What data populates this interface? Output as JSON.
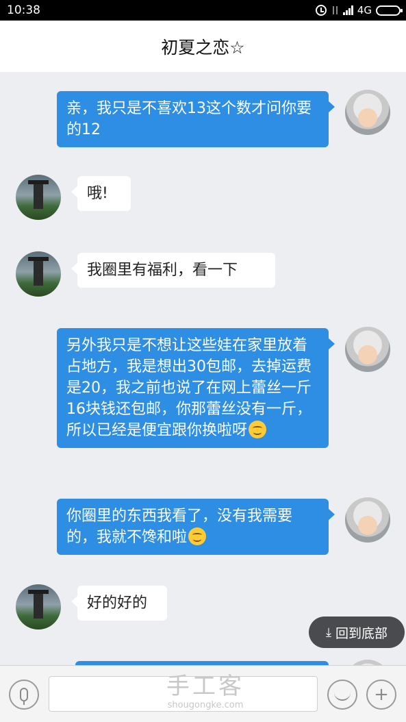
{
  "status_bar": {
    "time": "10:38",
    "network": "4G"
  },
  "header": {
    "title": "初夏之恋☆"
  },
  "messages": [
    {
      "side": "sent",
      "avatar": "doll-avatar",
      "text": "亲，我只是不喜欢13这个数才问你要的12"
    },
    {
      "side": "received",
      "avatar": "pagoda-avatar",
      "text": "哦!"
    },
    {
      "side": "received",
      "avatar": "pagoda-avatar",
      "text": "我圈里有福利，看一下"
    },
    {
      "side": "sent",
      "avatar": "doll-avatar",
      "text": "另外我只是不想让这些娃在家里放着占地方，我是想出30包邮，去掉运费是20，我之前也说了在网上蕾丝一斤16块钱还包邮，你那蕾丝没有一斤，所以已经是便宜跟你换啦呀",
      "emoji": "smiling-face-emoji"
    },
    {
      "side": "sent",
      "avatar": "doll-avatar",
      "text": "你圈里的东西我看了，没有我需要的，我就不馋和啦",
      "emoji": "smiling-face-emoji"
    },
    {
      "side": "received",
      "avatar": "pagoda-avatar",
      "text": "好的好的"
    }
  ],
  "back_to_bottom": {
    "label": "回到底部",
    "icon": "down-arrow-icon"
  },
  "input_bar": {
    "input_value": "",
    "voice_icon": "microphone-icon",
    "emoji_icon": "smile-icon",
    "more_icon": "plus-icon"
  },
  "watermark": {
    "main": "手工客",
    "sub": "shougongke.com"
  }
}
